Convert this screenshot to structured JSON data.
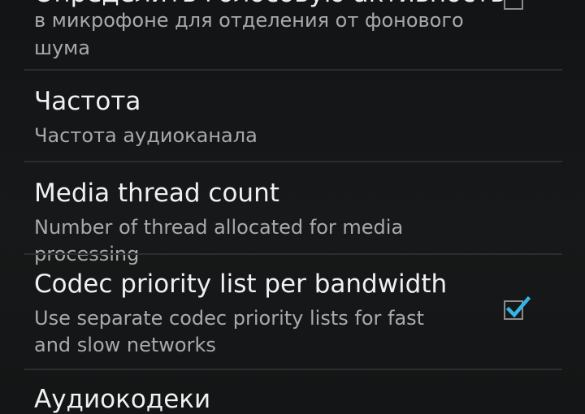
{
  "preferences": [
    {
      "title": "Определить голосовую активность",
      "summary": "в микрофоне для отделения от фонового шума",
      "checked": false
    },
    {
      "title": "Частота",
      "summary": "Частота аудиоканала"
    },
    {
      "title": "Media thread count",
      "summary": "Number of thread allocated for media processing"
    },
    {
      "title": "Codec priority list per bandwidth",
      "summary": "Use separate codec priority lists for fast and slow networks",
      "checked": true
    },
    {
      "title": "Аудиокодеки"
    }
  ],
  "colors": {
    "background": "#141618",
    "title": "#f0f0f0",
    "summary": "#a9a9a9",
    "divider": "#2b2d2f",
    "check_accent": "#33b5e5"
  }
}
